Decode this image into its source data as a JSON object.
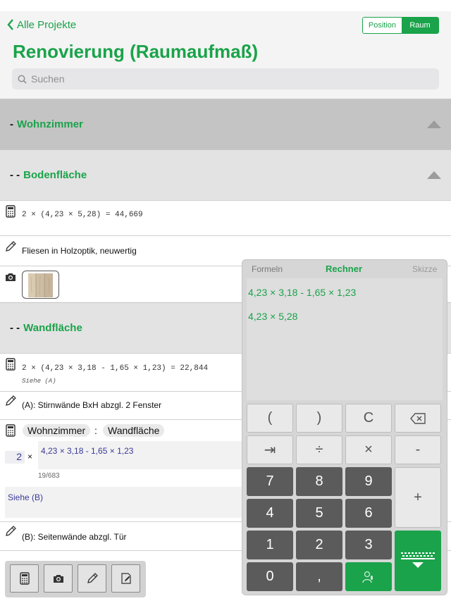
{
  "nav": {
    "back_label": "Alle Projekte",
    "segments": [
      "Position",
      "Raum"
    ],
    "selected_segment": "Raum",
    "title": "Renovierung (Raumaufmaß)",
    "search_placeholder": "Suchen"
  },
  "sections": {
    "wohnzimmer": {
      "prefix": "-",
      "name": "Wohnzimmer"
    },
    "bodenflaeche": {
      "prefix": "- -",
      "name": "Bodenfläche"
    },
    "wandflaeche": {
      "prefix": "- -",
      "name": "Wandfläche"
    }
  },
  "rows": {
    "boden_formula": "2 × (4,23 × 5,28) = 44,669",
    "boden_note": "Fliesen in Holzoptik, neuwertig",
    "wand_formula": "2 × (4,23 × 3,18 - 1,65 × 1,23) = 22,844",
    "wand_formula_sub": "Siehe (A)",
    "note_a": "(A): Stirnwände BxH abzgl. 2 Fenster",
    "edit_chip_room": "Wohnzimmer",
    "edit_chip_sep": ":",
    "edit_chip_area": "Wandfläche",
    "edit_multiplier": "2",
    "edit_times": "×",
    "edit_formula": "4,23 × 3,18 - 1,65 × 1,23",
    "edit_counter": "19/683",
    "edit_comment": "Siehe (B)",
    "note_b": "(B): Seitenwände abzgl. Tür"
  },
  "calculator": {
    "tabs": [
      "Formeln",
      "Rechner",
      "Skizze"
    ],
    "active_tab": "Rechner",
    "display_lines": [
      "4,23 × 3,18 - 1,65 × 1,23",
      "4,23 × 5,28"
    ],
    "keys": {
      "open_paren": "(",
      "close_paren": ")",
      "clear": "C",
      "tab": "⇥",
      "divide": "÷",
      "multiply": "×",
      "minus": "-",
      "plus": "+",
      "seven": "7",
      "eight": "8",
      "nine": "9",
      "four": "4",
      "five": "5",
      "six": "6",
      "one": "1",
      "two": "2",
      "three": "3",
      "zero": "0",
      "comma": ","
    }
  },
  "colors": {
    "accent": "#1aa34a",
    "section_dark": "#c4c4c4",
    "section_light": "#e3e3e3"
  },
  "toolbar": {
    "icons": [
      "calculator-icon",
      "camera-icon",
      "pencil-icon",
      "edit-note-icon"
    ]
  }
}
